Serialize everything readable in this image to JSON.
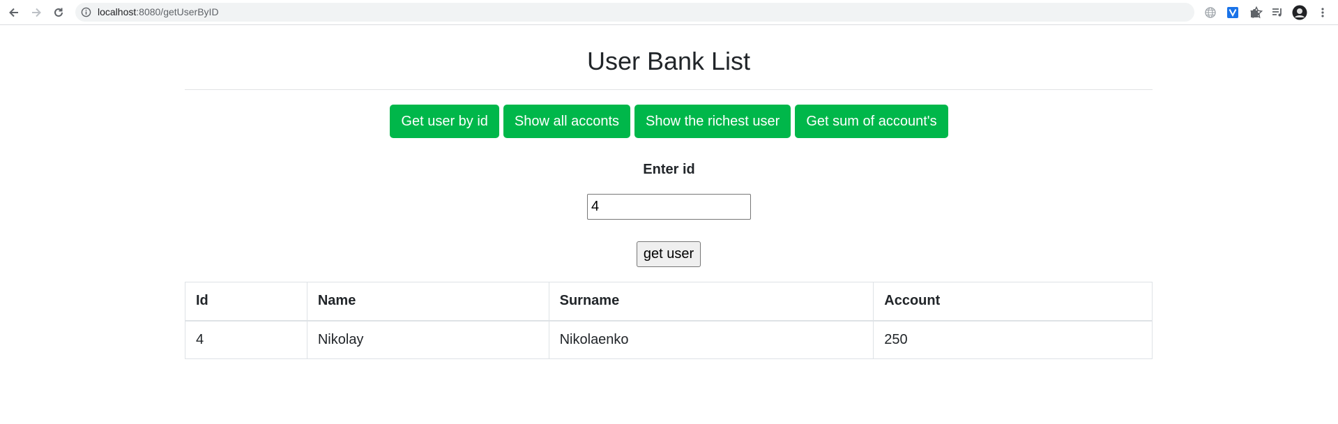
{
  "browser": {
    "url_host": "localhost",
    "url_path": ":8080/getUserByID"
  },
  "page": {
    "title": "User Bank List",
    "buttons": [
      "Get user by id",
      "Show all acconts",
      "Show the richest user",
      "Get sum of account's"
    ],
    "id_label": "Enter id",
    "id_value": "4",
    "submit_label": "get user"
  },
  "table": {
    "headers": [
      "Id",
      "Name",
      "Surname",
      "Account"
    ],
    "rows": [
      [
        "4",
        "Nikolay",
        "Nikolaenko",
        "250"
      ]
    ]
  },
  "colors": {
    "button_green": "#00b74a",
    "text": "#212529"
  }
}
